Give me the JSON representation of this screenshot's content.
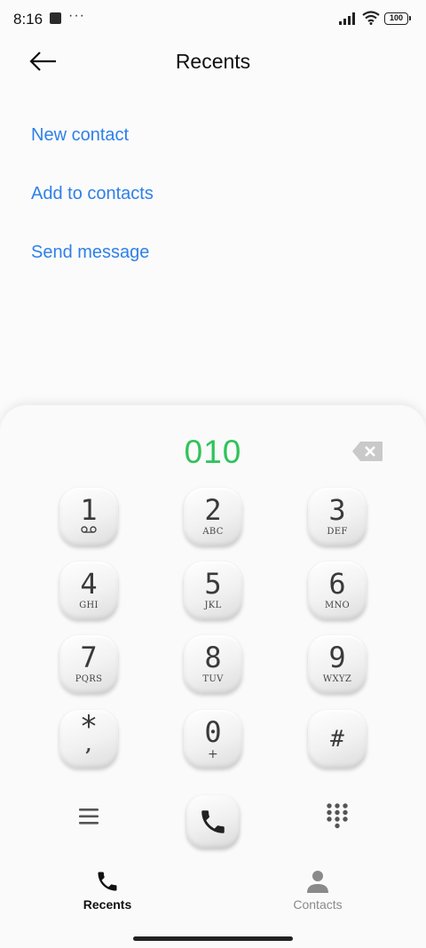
{
  "status_bar": {
    "time": "8:16",
    "dots": "···",
    "battery": "100"
  },
  "header": {
    "title": "Recents"
  },
  "actions": [
    {
      "label": "New contact"
    },
    {
      "label": "Add to contacts"
    },
    {
      "label": "Send message"
    }
  ],
  "dialer": {
    "number": "010",
    "keys": [
      {
        "digit": "1",
        "sub": ""
      },
      {
        "digit": "2",
        "sub": "ABC"
      },
      {
        "digit": "3",
        "sub": "DEF"
      },
      {
        "digit": "4",
        "sub": "GHI"
      },
      {
        "digit": "5",
        "sub": "JKL"
      },
      {
        "digit": "6",
        "sub": "MNO"
      },
      {
        "digit": "7",
        "sub": "PQRS"
      },
      {
        "digit": "8",
        "sub": "TUV"
      },
      {
        "digit": "9",
        "sub": "WXYZ"
      },
      {
        "digit": "*",
        "sub": ","
      },
      {
        "digit": "0",
        "sub": "+"
      },
      {
        "digit": "#",
        "sub": ""
      }
    ]
  },
  "bottom_nav": [
    {
      "label": "Recents",
      "icon": "phone-icon",
      "active": true
    },
    {
      "label": "Contacts",
      "icon": "person-icon",
      "active": false
    }
  ],
  "colors": {
    "accent": "#2f80e8",
    "dialed_number": "#2fc35a"
  }
}
